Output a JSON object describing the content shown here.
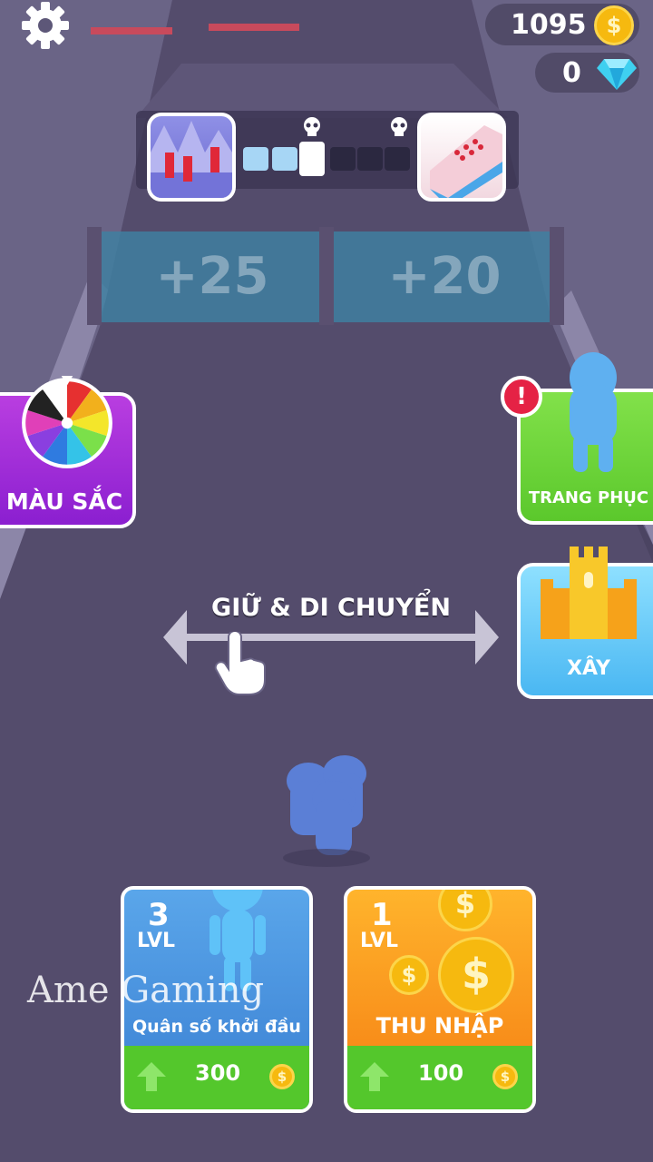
{
  "hud": {
    "coins": "1095",
    "gems": "0"
  },
  "gates": [
    {
      "label": "+25"
    },
    {
      "label": "+20"
    }
  ],
  "level_progress": {
    "filled_segments": 2,
    "total_segments": 6
  },
  "buttons": {
    "colors_label": "MÀU SẮC",
    "outfit_label": "TRANG PHỤC",
    "build_label": "XÂY",
    "outfit_alert": "!"
  },
  "hint": {
    "text": "GIỮ & DI CHUYỂN"
  },
  "upgrades": [
    {
      "level": "3",
      "level_label": "LVL",
      "title": "Quân số khởi đầu",
      "price": "300"
    },
    {
      "level": "1",
      "level_label": "LVL",
      "title": "THU NHẬP",
      "price": "100"
    }
  ],
  "watermark": "Ame Gaming",
  "colors": {
    "coin": "#f6b90f",
    "gem": "#3fd0f0",
    "upgrade_green": "#54c72c",
    "wheel": [
      "#e63030",
      "#f2b01c",
      "#f4e62a",
      "#7be04a",
      "#34c3e8",
      "#2f7be0",
      "#8a3fe0",
      "#e040b8",
      "#222222",
      "#ffffff"
    ]
  }
}
